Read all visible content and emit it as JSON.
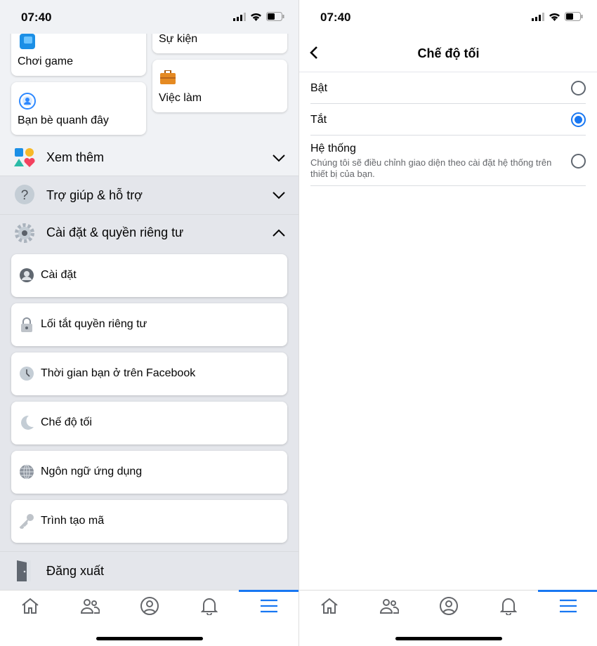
{
  "status": {
    "time": "07:40"
  },
  "left": {
    "shortcuts": [
      {
        "label": "Chơi game",
        "icon": "gaming-icon"
      },
      {
        "label": "Sự kiện",
        "icon": "events-icon"
      },
      {
        "label": "Việc làm",
        "icon": "jobs-icon"
      },
      {
        "label": "Bạn bè quanh đây",
        "icon": "nearby-friends-icon"
      }
    ],
    "sections": [
      {
        "label": "Xem thêm",
        "expanded": false
      },
      {
        "label": "Trợ giúp & hỗ trợ",
        "expanded": false
      },
      {
        "label": "Cài đặt & quyền riêng tư",
        "expanded": true
      }
    ],
    "settings_items": [
      {
        "label": "Cài đặt"
      },
      {
        "label": "Lối tắt quyền riêng tư"
      },
      {
        "label": "Thời gian bạn ở trên Facebook"
      },
      {
        "label": "Chế độ tối"
      },
      {
        "label": "Ngôn ngữ ứng dụng"
      },
      {
        "label": "Trình tạo mã"
      }
    ],
    "logout": "Đăng xuất"
  },
  "right": {
    "title": "Chế độ tối",
    "options": [
      {
        "label": "Bật",
        "selected": false
      },
      {
        "label": "Tắt",
        "selected": true
      },
      {
        "label": "Hệ thống",
        "description": "Chúng tôi sẽ điều chỉnh giao diện theo cài đặt hệ thống trên thiết bị của bạn.",
        "selected": false
      }
    ]
  },
  "nav": {
    "items": [
      "home",
      "friends",
      "profile",
      "notifications",
      "menu"
    ],
    "active": "menu"
  },
  "colors": {
    "accent": "#1877f2",
    "background": "#f0f2f5"
  }
}
